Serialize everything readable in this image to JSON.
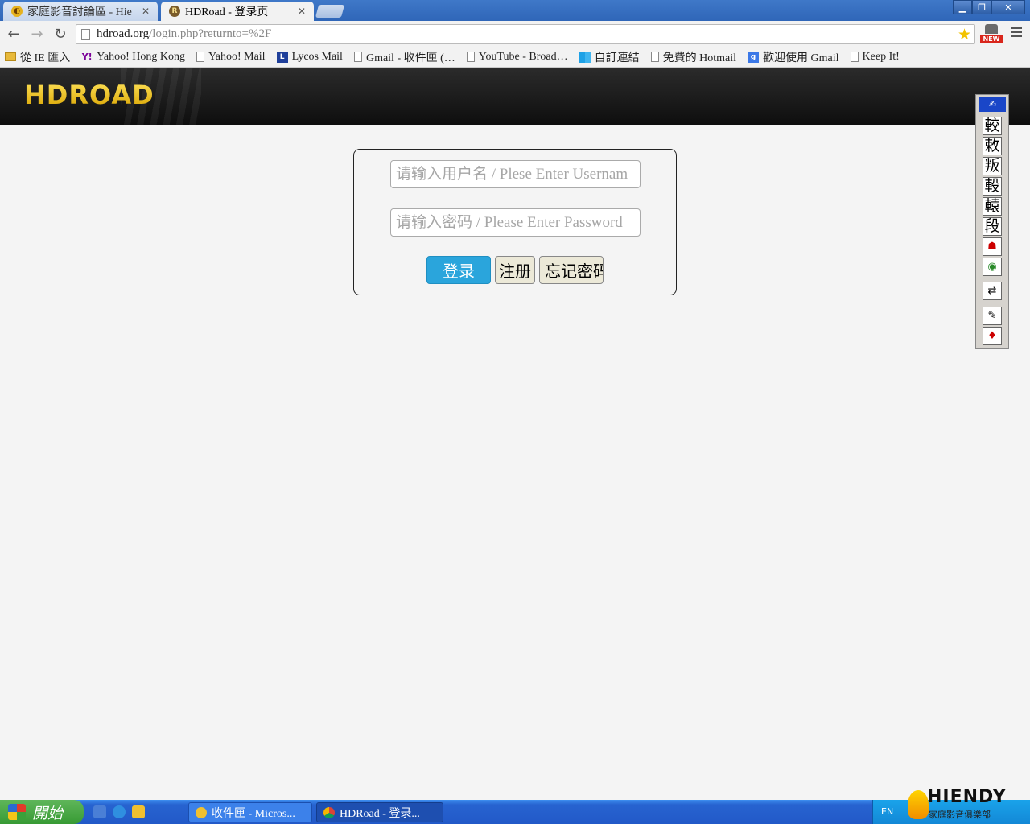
{
  "browser": {
    "tabs": [
      {
        "title": "家庭影音討論區 - Hie",
        "favicon": "hiendy-favicon"
      },
      {
        "title": "HDRoad - 登录页",
        "favicon": "hdroad-favicon"
      }
    ],
    "url_host": "hdroad.org",
    "url_path": "/login.php?returnto=%2F",
    "extension_badge": "NEW"
  },
  "bookmarks": [
    {
      "label": "從 IE 匯入",
      "icon": "folder-icon"
    },
    {
      "label": "Yahoo! Hong Kong",
      "icon": "yahoo-icon"
    },
    {
      "label": "Yahoo! Mail",
      "icon": "page-icon"
    },
    {
      "label": "Lycos Mail",
      "icon": "lycos-icon"
    },
    {
      "label": "Gmail - 收件匣 (…",
      "icon": "page-icon"
    },
    {
      "label": "YouTube - Broad…",
      "icon": "page-icon"
    },
    {
      "label": "自訂連結",
      "icon": "windows-icon"
    },
    {
      "label": "免費的 Hotmail",
      "icon": "page-icon"
    },
    {
      "label": "歡迎使用 Gmail",
      "icon": "google-icon"
    },
    {
      "label": "Keep It!",
      "icon": "page-icon"
    }
  ],
  "site": {
    "logo": "HDROAD"
  },
  "login": {
    "username_placeholder": "请输入用户名 / Plese Enter Usernam",
    "password_placeholder": "请输入密码 / Please Enter Password",
    "login_label": "登录",
    "register_label": "注册",
    "forgot_label": "忘记密码"
  },
  "ime": {
    "chars": [
      "較",
      "敕",
      "叛",
      "軗",
      "轅",
      "段"
    ]
  },
  "taskbar": {
    "start_label": "開始",
    "tasks": [
      "收件匣 - Micros...",
      "HDRoad - 登录..."
    ],
    "tray_lang": "EN"
  },
  "watermark": {
    "brand": "HIENDY",
    "sub": "家庭影音俱樂部"
  },
  "colors": {
    "login_button": "#2aa5dc",
    "logo_gold": "#f5c518",
    "header_bg": "#1a1a1a"
  }
}
